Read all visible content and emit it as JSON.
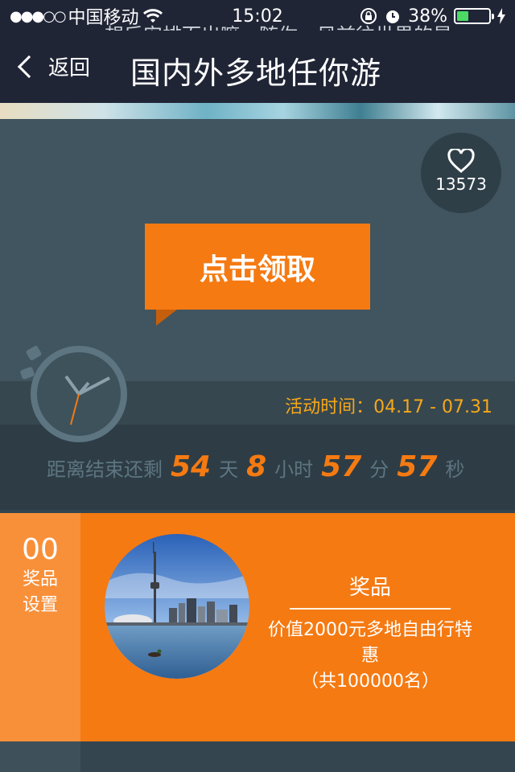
{
  "status_bar": {
    "signal_dots": "●●●○○",
    "carrier": "中国移动",
    "time": "15:02",
    "battery_percent": "38%",
    "battery_level": 0.38
  },
  "nav": {
    "back_label": "返回",
    "title": "国内外多地任你游"
  },
  "like": {
    "count": "13573"
  },
  "claim_button": "点击领取",
  "activity_time": "活动时间：04.17 - 07.31",
  "countdown": {
    "prefix": "距离结束还剩",
    "days": "54",
    "days_unit": "天",
    "hours": "8",
    "hours_unit": "小时",
    "minutes": "57",
    "minutes_unit": "分",
    "seconds": "57",
    "seconds_unit": "秒"
  },
  "prize": {
    "number": "00",
    "side_label_1": "奖品",
    "side_label_2": "设置",
    "title": "奖品",
    "desc_line_1": "价值2000元多地自由行特",
    "desc_line_2": "惠",
    "desc_line_3": "（共100000名）"
  },
  "bottom_text": "想后安排而出嘛，随你，风前往世界的是"
}
